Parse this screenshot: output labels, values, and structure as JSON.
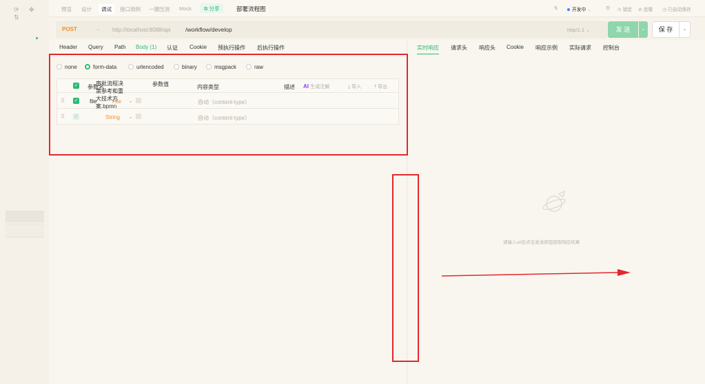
{
  "sidebar": {
    "toolbar_glyphs": "⟳ ✥ ⇅"
  },
  "tabs": [
    "预览",
    "设计",
    "调试",
    "接口用例",
    "一键压测",
    "Mock"
  ],
  "active_tab": "调试",
  "share_label": "分享",
  "doc_title": "部署流程图",
  "top_right": {
    "env_label": "开发中",
    "lock_label": "锁定",
    "clone_label": "克隆",
    "autosave_label": "已自动保存"
  },
  "request": {
    "method": "POST",
    "base_url": "http://localhost:8088/api",
    "path": "/workflow/develop",
    "http_version": "http/1.1",
    "send_label": "发 送",
    "save_label": "保 存"
  },
  "request_tabs": [
    "Header",
    "Query",
    "Path",
    "Body (1)",
    "认证",
    "Cookie",
    "预执行操作",
    "后执行操作"
  ],
  "active_request_tab": "Body (1)",
  "body_types": [
    "none",
    "form-data",
    "urlencoded",
    "binary",
    "msgpack",
    "raw"
  ],
  "selected_body_type": "form-data",
  "params_table": {
    "headers": {
      "name": "参数名",
      "value": "参数值",
      "content_type": "内容类型",
      "desc": "描述",
      "ai_badge": "AI",
      "ai_label": "生成注解",
      "import_label": "导入",
      "export_label": "导出"
    },
    "rows": [
      {
        "name": "file",
        "type": "File",
        "value": "审批流程决策参考和重大技术方案.bpmn",
        "content_type": "自动（content-type）",
        "checked": true
      },
      {
        "name": "",
        "type": "String",
        "value": "",
        "content_type": "自动（content-type）",
        "checked": false
      }
    ]
  },
  "response_tabs": [
    "实时响应",
    "请求头",
    "响应头",
    "Cookie",
    "响应示例",
    "实际请求",
    "控制台"
  ],
  "active_response_tab": "实时响应",
  "empty_response_text": "请输入url后点击发送按钮获取响应结果"
}
